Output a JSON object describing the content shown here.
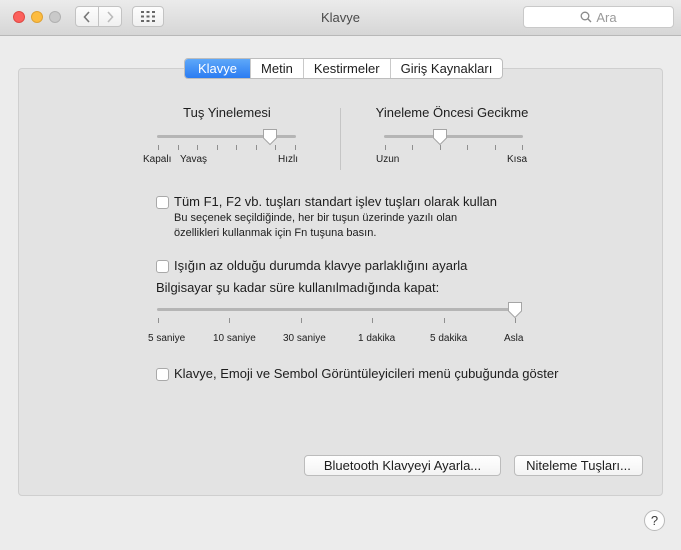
{
  "window": {
    "title": "Klavye"
  },
  "search": {
    "placeholder": "Ara"
  },
  "tabs": [
    {
      "label": "Klavye",
      "active": true
    },
    {
      "label": "Metin",
      "active": false
    },
    {
      "label": "Kestirmeler",
      "active": false
    },
    {
      "label": "Giriş Kaynakları",
      "active": false
    }
  ],
  "key_repeat": {
    "title": "Tuş Yinelemesi",
    "labels": [
      "Kapalı",
      "Yavaş",
      "Hızlı"
    ],
    "value_fraction": 0.82
  },
  "delay_until_repeat": {
    "title": "Yineleme Öncesi Gecikme",
    "labels": [
      "Uzun",
      "Kısa"
    ],
    "value_fraction": 0.4
  },
  "fn_keys": {
    "label": "Tüm F1, F2 vb. tuşları standart işlev tuşları olarak kullan",
    "help_line1": "Bu seçenek seçildiğinde, her bir tuşun üzerinde yazılı olan",
    "help_line2": "özellikleri kullanmak için Fn tuşuna basın.",
    "checked": false
  },
  "backlight": {
    "label": "Işığın az olduğu durumda klavye parlaklığını ayarla",
    "checked": false
  },
  "idle_off": {
    "title": "Bilgisayar şu kadar süre kullanılmadığında kapat:",
    "labels": [
      "5 saniye",
      "10 saniye",
      "30 saniye",
      "1 dakika",
      "5 dakika",
      "Asla"
    ],
    "value_fraction": 1.0
  },
  "menu_viewer": {
    "label": "Klavye, Emoji ve Sembol Görüntüleyicileri menü çubuğunda göster",
    "checked": false
  },
  "buttons": {
    "bluetooth": "Bluetooth Klavyeyi Ayarla...",
    "modifier": "Niteleme Tuşları..."
  },
  "help": {
    "label": "?"
  },
  "colors": {
    "accent": "#2b7cf2",
    "close": "#fc605c",
    "minimize": "#fdbc40",
    "zoom": "#c9c9c9"
  },
  "icons": {
    "back": "chevron-left-icon",
    "forward": "chevron-right-icon",
    "grid": "grid-icon",
    "search": "magnifier-icon"
  }
}
